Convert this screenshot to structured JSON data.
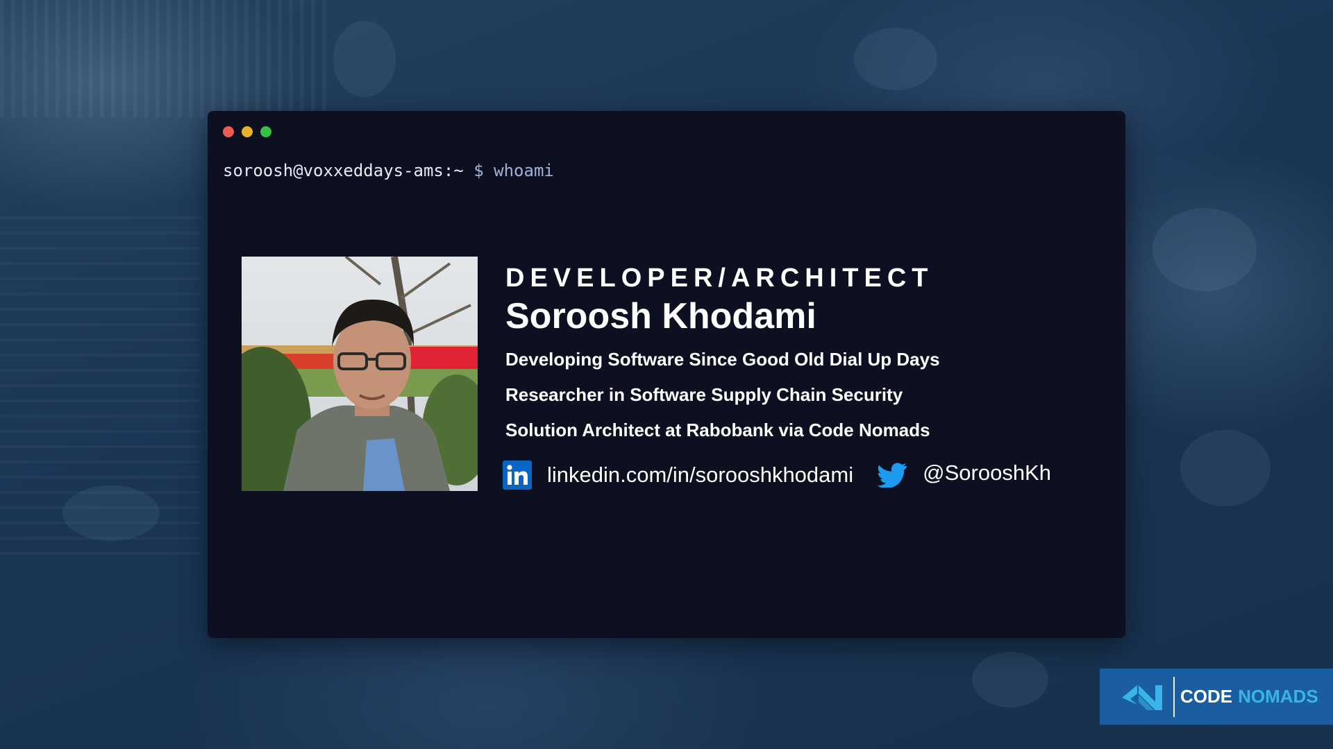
{
  "window": {
    "controls": [
      "close",
      "minimize",
      "maximize"
    ],
    "prompt": {
      "user_host": "soroosh@voxxeddays-ams:~",
      "symbol": "$",
      "command": "whoami"
    }
  },
  "profile": {
    "photo_alt": "Soroosh Khodami",
    "role": "DEVELOPER/ARCHITECT",
    "name": "Soroosh Khodami",
    "lines": [
      "Developing Software Since Good Old Dial Up Days",
      "Researcher in Software Supply Chain Security",
      "Solution Architect at Rabobank via Code Nomads"
    ],
    "linkedin": {
      "icon": "linkedin-icon",
      "text": "linkedin.com/in/sorooshkhodami"
    },
    "twitter": {
      "icon": "twitter-icon",
      "text": "@SorooshKh"
    }
  },
  "brand": {
    "code": "CODE",
    "nomads": "NOMADS"
  },
  "colors": {
    "background": "#1a3554",
    "terminal": "#0c1020",
    "close": "#ed5b55",
    "minimize": "#e8b12a",
    "maximize": "#36c144",
    "linkedin": "#0a66c2",
    "twitter": "#1d9bf0",
    "brand_bg": "#1a5ea0",
    "brand_accent": "#39b4e8"
  }
}
